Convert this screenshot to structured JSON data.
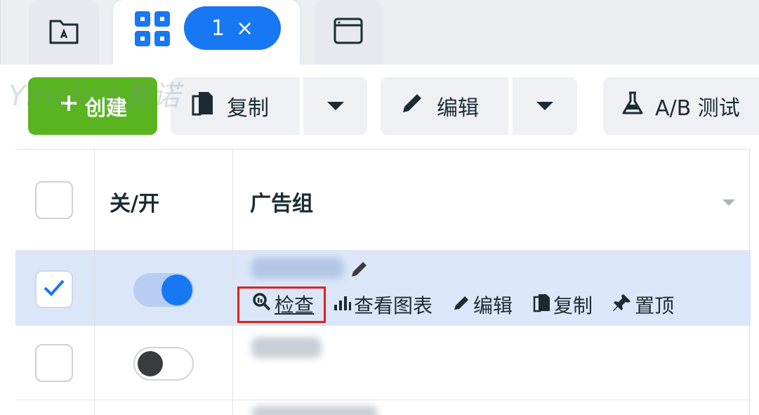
{
  "tabs": {
    "badge_count": "1",
    "badge_close": "×",
    "items": [
      {
        "icon": "folder-icon"
      },
      {
        "icon": "grid-icon"
      },
      {
        "icon": "window-icon"
      }
    ]
  },
  "toolbar": {
    "create_label": "创建",
    "copy_label": "复制",
    "edit_label": "编辑",
    "ab_label": "A/B 测试",
    "accent_color": "#59b41f"
  },
  "watermark": {
    "text": "Yinolink易诺"
  },
  "table": {
    "headers": {
      "toggle": "关/开",
      "adset": "广告组"
    },
    "rows": [
      {
        "checked": true,
        "toggle_on": true
      },
      {
        "checked": false,
        "toggle_on": false
      }
    ],
    "row_actions": {
      "inspect": "检查",
      "view_chart": "查看图表",
      "edit": "编辑",
      "copy": "复制",
      "pin": "置顶"
    }
  },
  "colors": {
    "primary": "#1877f2",
    "selected_row": "#dbe7f8",
    "highlight_box": "#e02020"
  }
}
